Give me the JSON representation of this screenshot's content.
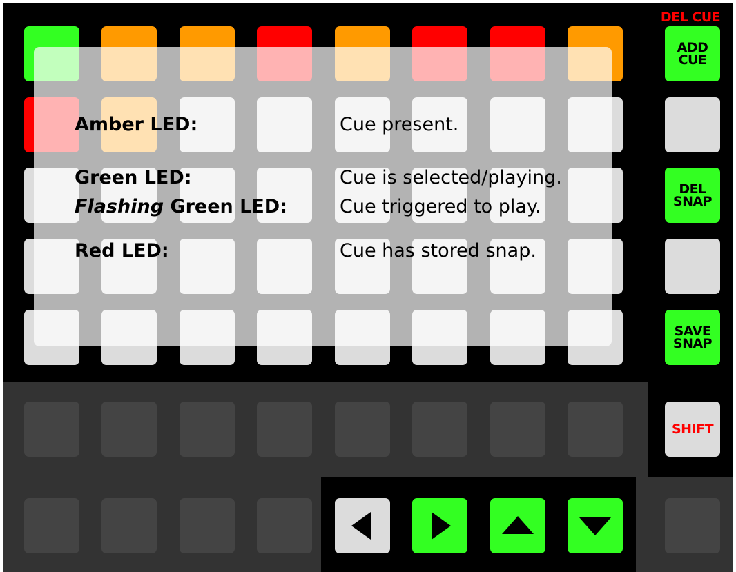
{
  "header": {
    "del_cue_label": "DEL CUE"
  },
  "side_buttons": {
    "add_cue": "ADD\nCUE",
    "del_snap": "DEL\nSNAP",
    "save_snap": "SAVE\nSNAP",
    "shift": "SHIFT"
  },
  "grid": {
    "row1_states": [
      "green",
      "amber",
      "amber",
      "red",
      "amber",
      "red",
      "red",
      "amber"
    ],
    "row2_states": [
      "red",
      "amber",
      "off",
      "off",
      "off",
      "off",
      "off",
      "off"
    ]
  },
  "legend": {
    "amber_key": "Amber LED:",
    "amber_desc": "Cue present.",
    "green_key": "Green LED:",
    "green_desc": "Cue is selected/playing.",
    "flashing_word": "Flashing",
    "flashing_key_rest": " Green LED:",
    "flashing_desc": "Cue triggered to play.",
    "red_key": "Red LED:",
    "red_desc": "Cue has stored snap."
  },
  "nav_buttons": [
    {
      "icon": "left-arrow-icon",
      "active": false
    },
    {
      "icon": "right-arrow-icon",
      "active": true
    },
    {
      "icon": "up-arrow-icon",
      "active": true
    },
    {
      "icon": "down-arrow-icon",
      "active": true
    }
  ],
  "colors": {
    "green": "#33ff22",
    "amber": "#ff9a00",
    "red": "#ff0000",
    "off": "#dcdcdc",
    "dark_pad": "#444444",
    "panel": "#000000",
    "dark_panel": "#333333"
  }
}
